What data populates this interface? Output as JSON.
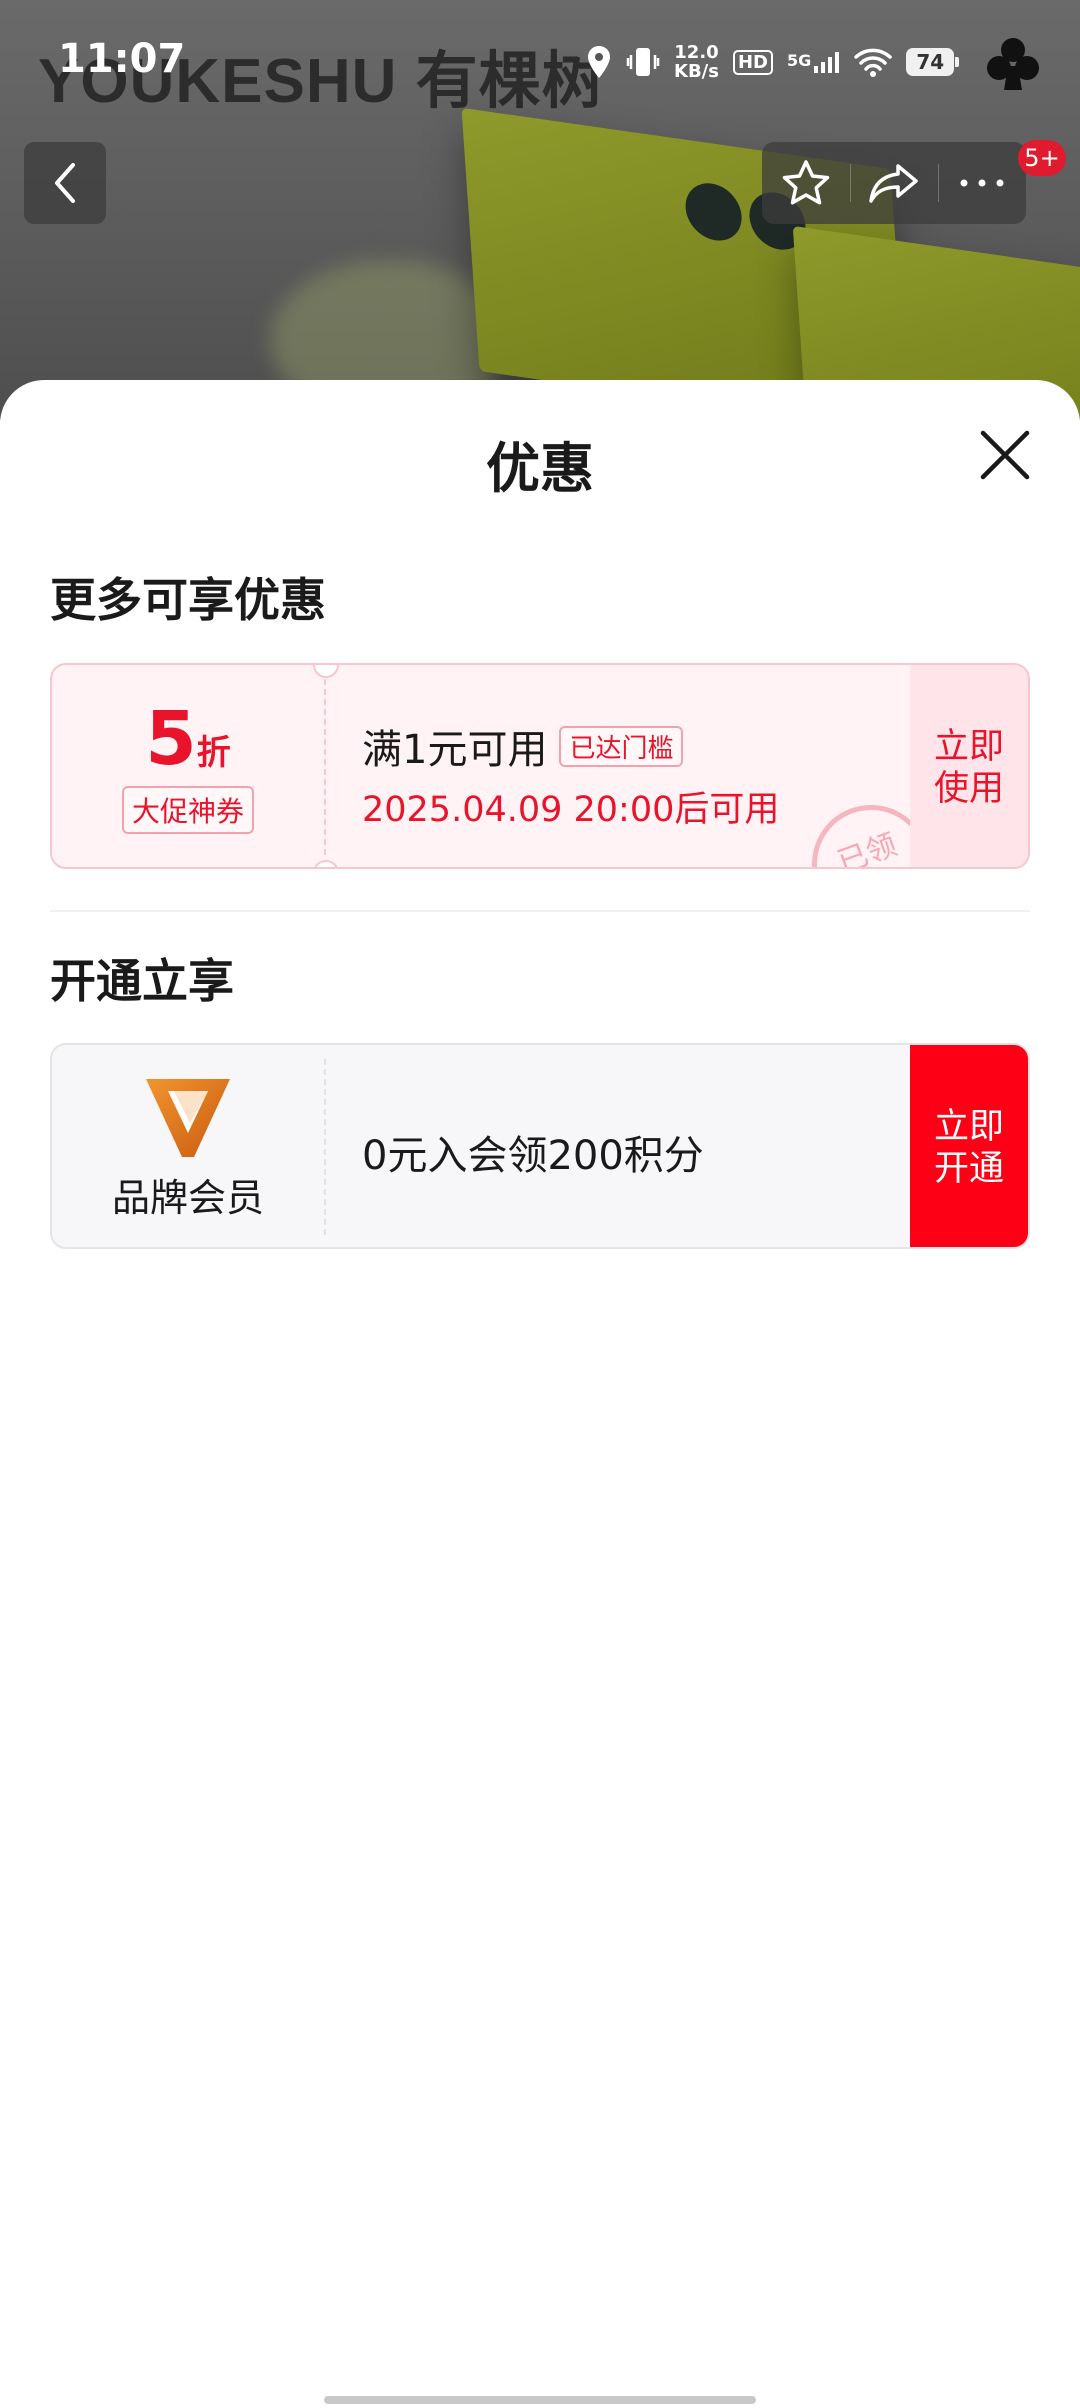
{
  "status_bar": {
    "time": "11:07",
    "speed_value": "12.0",
    "speed_unit": "KB/s",
    "hd": "HD",
    "network": "5G",
    "battery": "74"
  },
  "background": {
    "brand_text": "YOUKESHU 有棵树"
  },
  "header": {
    "badge": "5+"
  },
  "sheet": {
    "title": "优惠",
    "more_section": {
      "title": "更多可享优惠",
      "coupon": {
        "discount": "5",
        "discount_unit": "折",
        "tag": "大促神券",
        "condition": "满1元可用",
        "threshold_tag": "已达门槛",
        "valid_time": "2025.04.09 20:00后可用",
        "stamp": "已领",
        "action": "立即使用"
      }
    },
    "open_section": {
      "title": "开通立享",
      "membership": {
        "label": "品牌会员",
        "offer": "0元入会领200积分",
        "action": "立即开通"
      }
    }
  },
  "colors": {
    "accent_red": "#e8142b",
    "cta_red": "#fd0015",
    "logo_orange": "#e87a1e"
  }
}
